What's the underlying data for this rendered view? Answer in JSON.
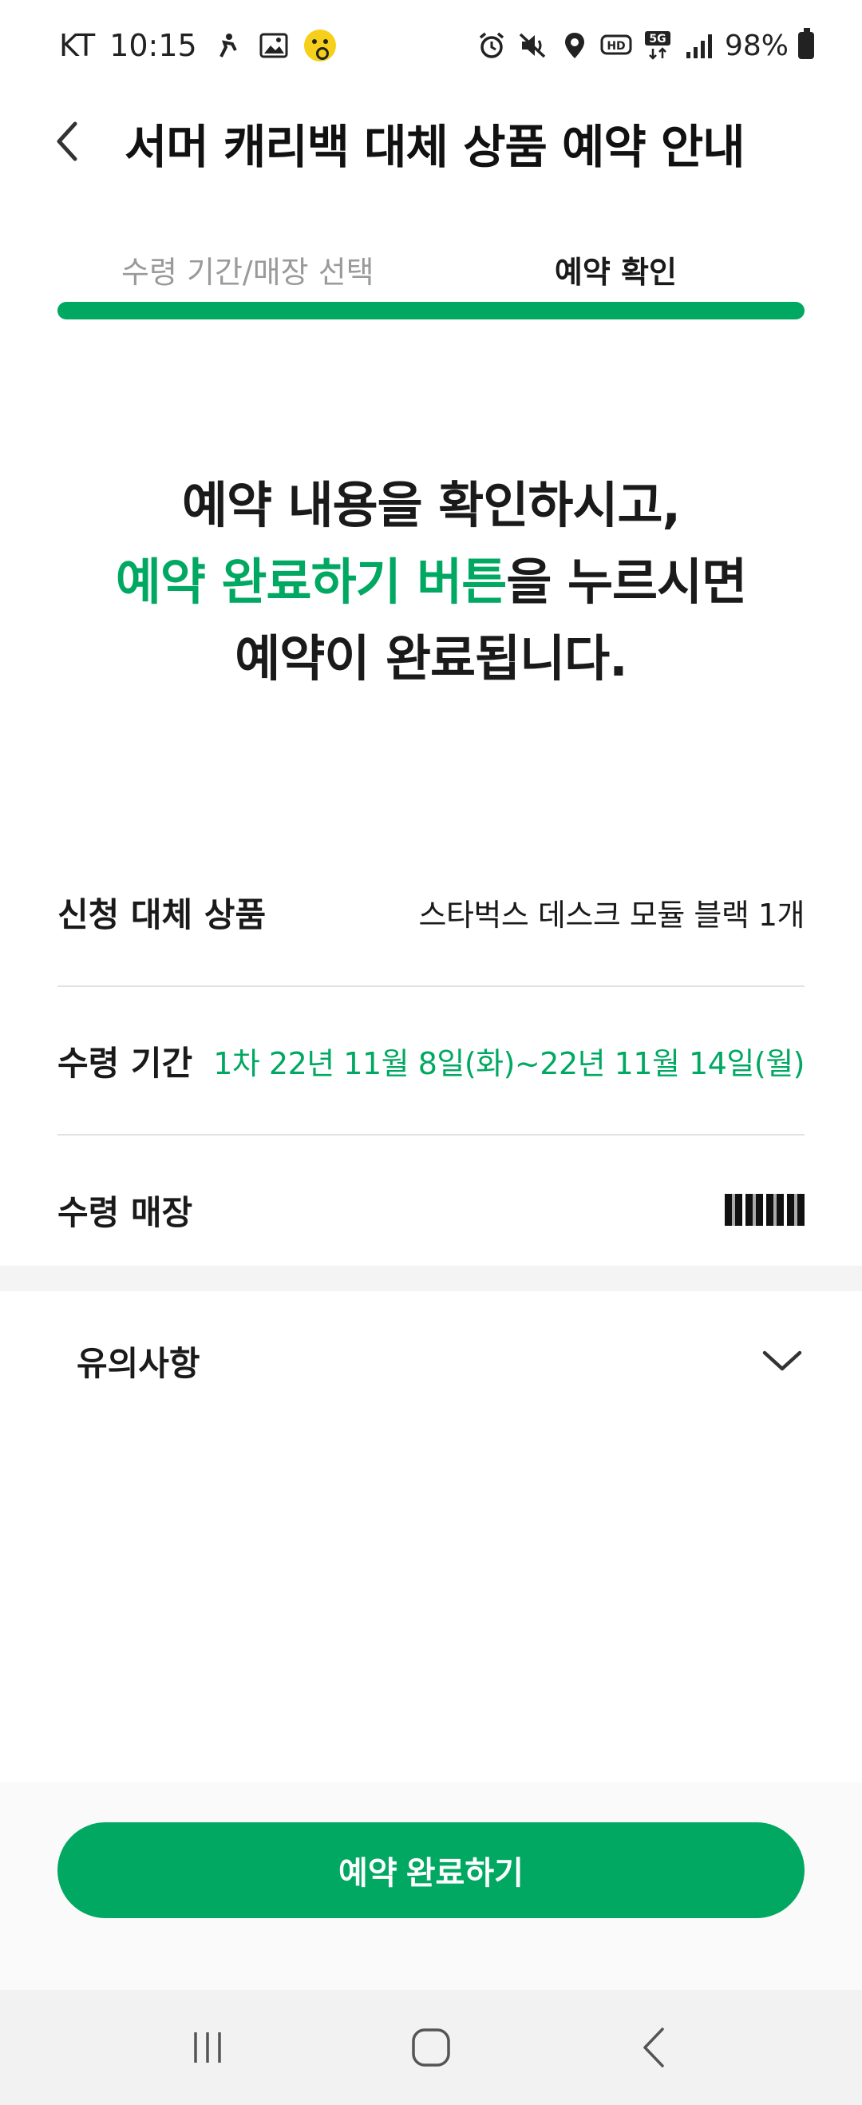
{
  "status_bar": {
    "carrier": "KT",
    "time": "10:15",
    "battery": "98%",
    "icons_left": [
      "motion-icon",
      "gallery-icon",
      "face-emoji-icon"
    ],
    "icons_right": [
      "alarm-icon",
      "mute-icon",
      "location-icon",
      "hd-icon",
      "5g-icon",
      "signal-icon",
      "battery-icon"
    ]
  },
  "header": {
    "title": "서머 캐리백 대체 상품 예약 안내"
  },
  "tabs": [
    {
      "label": "수령 기간/매장 선택",
      "active": false
    },
    {
      "label": "예약 확인",
      "active": true
    }
  ],
  "progress": 1.0,
  "message": {
    "line1": "예약 내용을 확인하시고,",
    "line2_accent": "예약 완료하기 버튼",
    "line2_rest": "을 누르시면",
    "line3": "예약이 완료됩니다."
  },
  "info_rows": [
    {
      "label": "신청 대체 상품",
      "value": "스타벅스 데스크 모듈 블랙 1개"
    },
    {
      "label": "수령 기간",
      "value": "1차 22년 11월 8일(화)~22년 11월 14일(월)"
    },
    {
      "label": "수령 매장",
      "value": ""
    }
  ],
  "notice": {
    "label": "유의사항"
  },
  "cta": {
    "label": "예약 완료하기"
  },
  "colors": {
    "accent": "#00a862",
    "text": "#1a1a1a",
    "muted": "#9a9a9a"
  }
}
